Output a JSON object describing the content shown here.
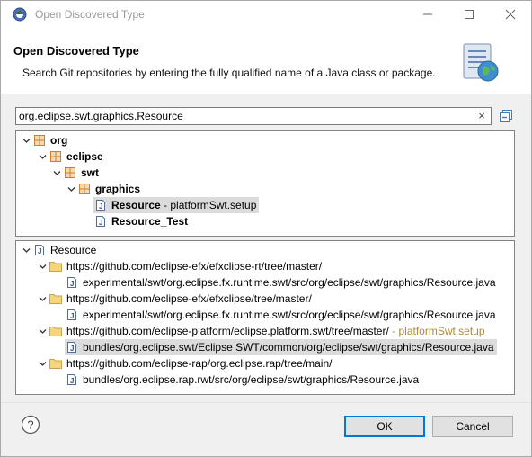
{
  "window": {
    "title": "Open Discovered Type",
    "controls": {
      "minimize": "—",
      "maximize": "☐",
      "close": "✕"
    }
  },
  "header": {
    "title": "Open Discovered Type",
    "description": "Search Git repositories by entering the fully qualified name of a Java class or package."
  },
  "search": {
    "value": "org.eclipse.swt.graphics.Resource",
    "clear_icon": "×"
  },
  "package_tree": {
    "items": [
      {
        "label": "org",
        "icon": "package-icon",
        "expanded": true
      },
      {
        "label": "eclipse",
        "icon": "package-icon",
        "expanded": true
      },
      {
        "label": "swt",
        "icon": "package-icon",
        "expanded": true
      },
      {
        "label": "graphics",
        "icon": "package-icon",
        "expanded": true
      },
      {
        "label": "Resource",
        "suffix": " - platformSwt.setup",
        "icon": "java-file-icon",
        "selected": true
      },
      {
        "label": "Resource_Test",
        "icon": "java-file-icon"
      }
    ]
  },
  "location_tree": {
    "root": {
      "label": "Resource",
      "icon": "java-file-icon"
    },
    "items": [
      {
        "repo": "https://github.com/eclipse-efx/efxclipse-rt/tree/master/",
        "file": "experimental/swt/org.eclipse.fx.runtime.swt/src/org/eclipse/swt/graphics/Resource.java"
      },
      {
        "repo": "https://github.com/eclipse-efx/efxclipse/tree/master/",
        "file": "experimental/swt/org.eclipse.fx.runtime.swt/src/org/eclipse/swt/graphics/Resource.java"
      },
      {
        "repo": "https://github.com/eclipse-platform/eclipse.platform.swt/tree/master/",
        "repo_suffix": " - platformSwt.setup",
        "file": "bundles/org.eclipse.swt/Eclipse SWT/common/org/eclipse/swt/graphics/Resource.java",
        "selected": true
      },
      {
        "repo": "https://github.com/eclipse-rap/org.eclipse.rap/tree/main/",
        "file": "bundles/org.eclipse.rap.rwt/src/org/eclipse/swt/graphics/Resource.java"
      }
    ]
  },
  "footer": {
    "help_icon": "?",
    "ok_label": "OK",
    "cancel_label": "Cancel"
  },
  "colors": {
    "accent": "#0078d7",
    "package_icon": "#c9812f",
    "folder_icon": "#e8c069",
    "decoration_text": "#ad8a3c"
  }
}
